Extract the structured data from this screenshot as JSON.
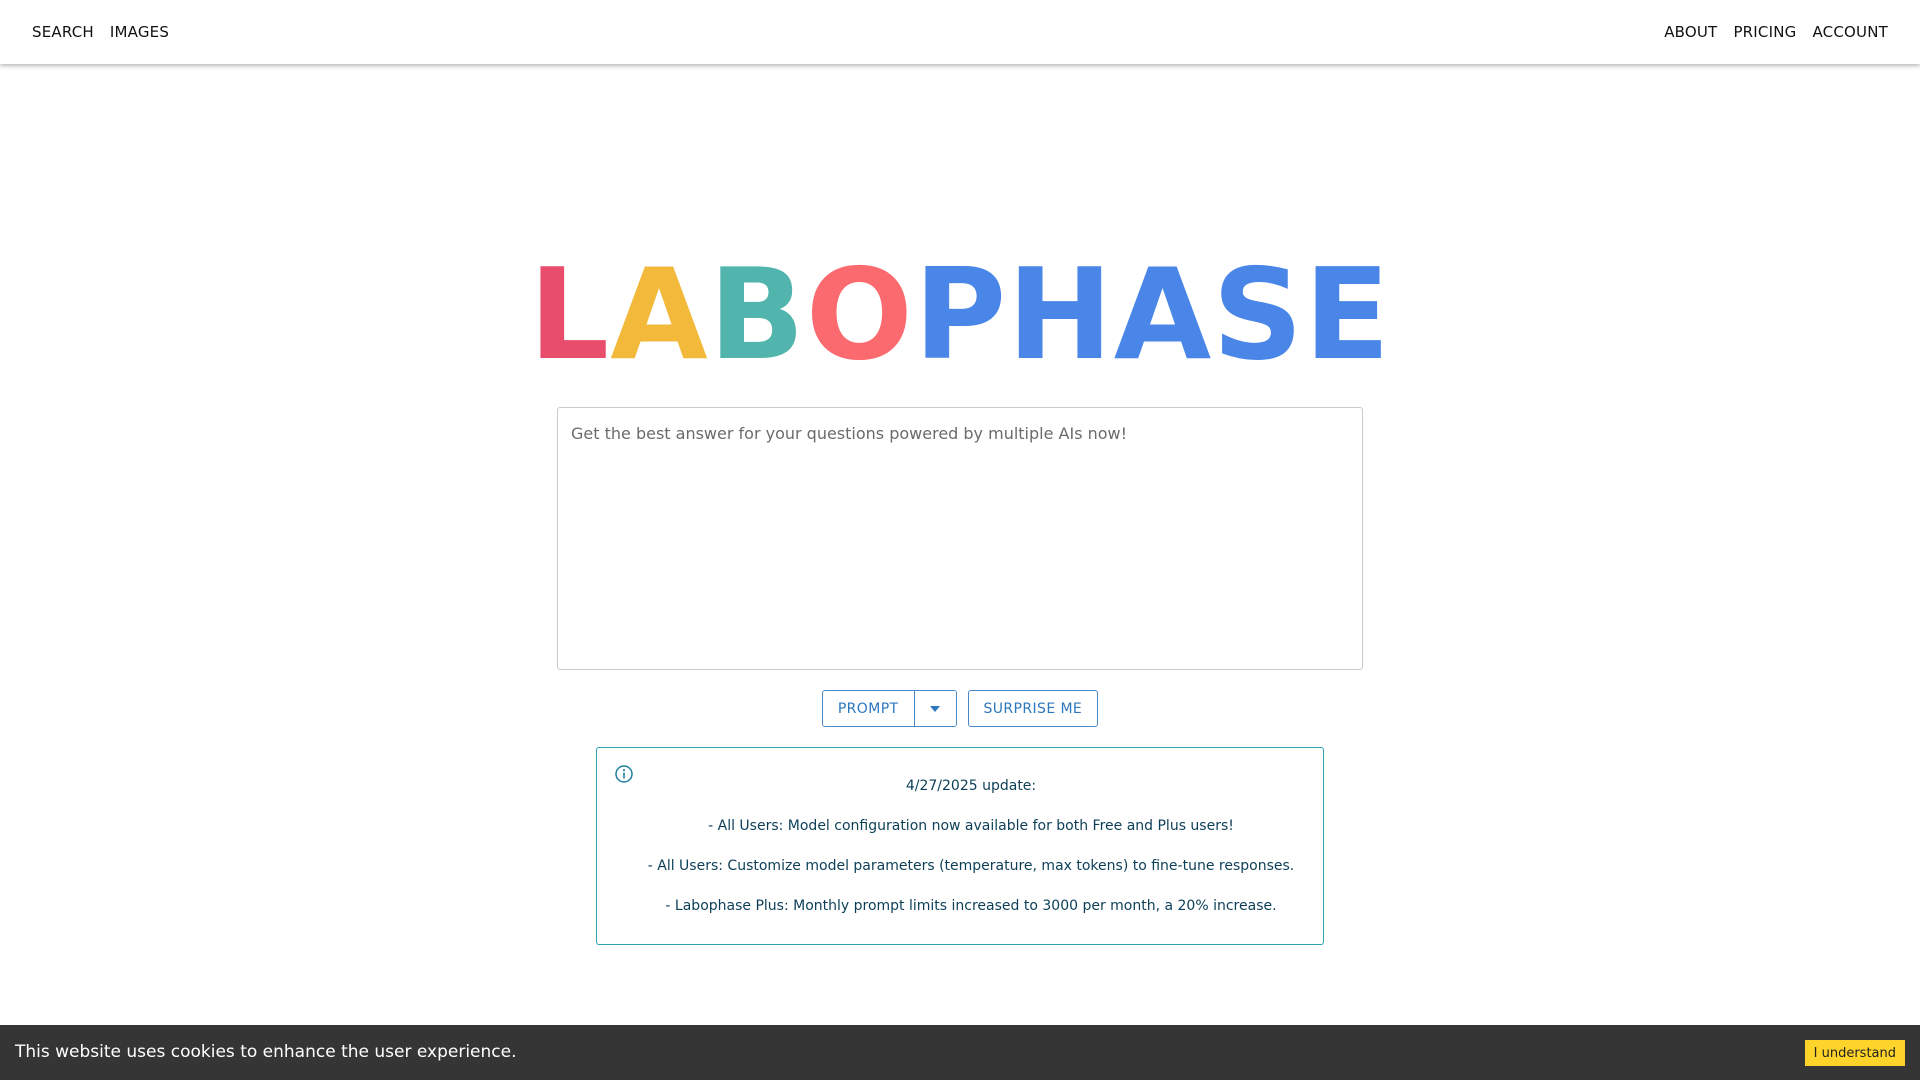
{
  "nav": {
    "left": [
      {
        "label": "SEARCH"
      },
      {
        "label": "IMAGES"
      }
    ],
    "right": [
      {
        "label": "ABOUT"
      },
      {
        "label": "PRICING"
      },
      {
        "label": "ACCOUNT"
      }
    ]
  },
  "logo": {
    "text": "LABOPHASE",
    "letters": [
      {
        "char": "L",
        "color": "#e84e6c"
      },
      {
        "char": "A",
        "color": "#f2b93b"
      },
      {
        "char": "B",
        "color": "#52b5ad"
      },
      {
        "char": "O",
        "color": "#fa6a6e"
      },
      {
        "char": "P",
        "color": "#4a86e8"
      },
      {
        "char": "H",
        "color": "#4a86e8"
      },
      {
        "char": "A",
        "color": "#4a86e8"
      },
      {
        "char": "S",
        "color": "#4a86e8"
      },
      {
        "char": "E",
        "color": "#4a86e8"
      }
    ]
  },
  "prompt": {
    "placeholder": "Get the best answer for your questions powered by multiple AIs now!",
    "value": ""
  },
  "buttons": {
    "prompt_label": "PROMPT",
    "dropdown_icon": "caret-down-icon",
    "surprise_label": "SURPRISE ME"
  },
  "alert": {
    "icon": "info-icon",
    "title": "4/27/2025 update:",
    "lines": [
      "- All Users: Model configuration now available for both Free and Plus users!",
      "- All Users: Customize model parameters (temperature, max tokens) to fine-tune responses.",
      "- Labophase Plus: Monthly prompt limits increased to 3000 per month, a 20% increase."
    ],
    "color": "#2ea2b5"
  },
  "cookie": {
    "text": "This website uses cookies to enhance the user experience.",
    "button_label": "I understand",
    "button_color": "#ffd42a"
  }
}
